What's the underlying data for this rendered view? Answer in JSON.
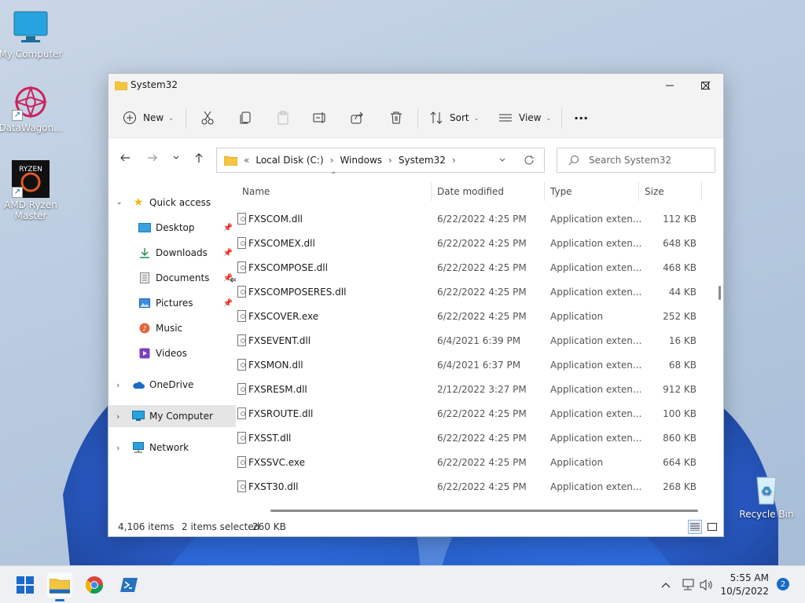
{
  "desktop": {
    "icons": [
      {
        "label": "My Computer"
      },
      {
        "label": "DataWagon..."
      },
      {
        "label": "AMD Ryzen Master"
      },
      {
        "label": "Recycle Bin"
      }
    ]
  },
  "window": {
    "title": "System32",
    "toolbar": {
      "new_label": "New",
      "sort_label": "Sort",
      "view_label": "View",
      "more_label": "···"
    },
    "address": {
      "prefix": "«",
      "crumbs": [
        "Local Disk (C:)",
        "Windows",
        "System32"
      ]
    },
    "search": {
      "placeholder": "Search System32"
    },
    "nav": {
      "quick_access": "Quick access",
      "items": [
        "Desktop",
        "Downloads",
        "Documents",
        "Pictures",
        "Music",
        "Videos"
      ],
      "onedrive": "OneDrive",
      "my_computer": "My Computer",
      "network": "Network"
    },
    "columns": {
      "name": "Name",
      "date": "Date modified",
      "type": "Type",
      "size": "Size"
    },
    "files": [
      {
        "name": "FXSCOM.dll",
        "date": "6/22/2022 4:25 PM",
        "type": "Application exten...",
        "size": "112 KB"
      },
      {
        "name": "FXSCOMEX.dll",
        "date": "6/22/2022 4:25 PM",
        "type": "Application exten...",
        "size": "648 KB"
      },
      {
        "name": "FXSCOMPOSE.dll",
        "date": "6/22/2022 4:25 PM",
        "type": "Application exten...",
        "size": "468 KB"
      },
      {
        "name": "FXSCOMPOSERES.dll",
        "date": "6/22/2022 4:25 PM",
        "type": "Application exten...",
        "size": "44 KB"
      },
      {
        "name": "FXSCOVER.exe",
        "date": "6/22/2022 4:25 PM",
        "type": "Application",
        "size": "252 KB"
      },
      {
        "name": "FXSEVENT.dll",
        "date": "6/4/2021 6:39 PM",
        "type": "Application exten...",
        "size": "16 KB"
      },
      {
        "name": "FXSMON.dll",
        "date": "6/4/2021 6:37 PM",
        "type": "Application exten...",
        "size": "68 KB"
      },
      {
        "name": "FXSRESM.dll",
        "date": "2/12/2022 3:27 PM",
        "type": "Application exten...",
        "size": "912 KB"
      },
      {
        "name": "FXSROUTE.dll",
        "date": "6/22/2022 4:25 PM",
        "type": "Application exten...",
        "size": "100 KB"
      },
      {
        "name": "FXSST.dll",
        "date": "6/22/2022 4:25 PM",
        "type": "Application exten...",
        "size": "860 KB"
      },
      {
        "name": "FXSSVC.exe",
        "date": "6/22/2022 4:25 PM",
        "type": "Application",
        "size": "664 KB"
      },
      {
        "name": "FXST30.dll",
        "date": "6/22/2022 4:25 PM",
        "type": "Application exten...",
        "size": "268 KB"
      }
    ],
    "status": {
      "count": "4,106 items",
      "selected": "2 items selected",
      "size": "260 KB"
    }
  },
  "taskbar": {
    "time": "5:55 AM",
    "date": "10/5/2022",
    "notifications": "2"
  },
  "colors": {
    "accent": "#1b6ac9",
    "folder": "#f4c542"
  }
}
